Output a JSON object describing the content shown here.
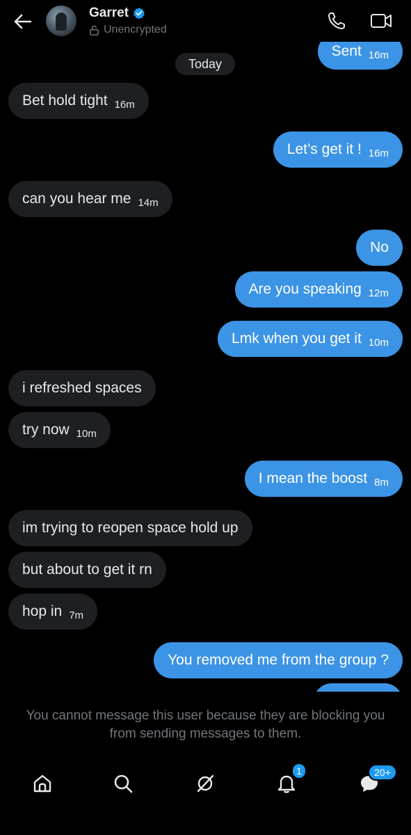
{
  "header": {
    "name": "Garret",
    "encryption_status": "Unencrypted"
  },
  "date_divider": "Today",
  "messages": [
    {
      "dir": "out",
      "text": "Sent",
      "time": "16m"
    },
    {
      "dir": "in",
      "text": "Bet hold tight",
      "time": "16m"
    },
    {
      "dir": "out",
      "text": "Let’s get it !",
      "time": "16m"
    },
    {
      "dir": "in",
      "text": "can you hear me",
      "time": "14m"
    },
    {
      "dir": "out",
      "text": "No",
      "time": ""
    },
    {
      "dir": "out",
      "text": "Are you speaking",
      "time": "12m"
    },
    {
      "dir": "out",
      "text": "Lmk when you get it",
      "time": "10m"
    },
    {
      "dir": "in",
      "text": "i refreshed spaces",
      "time": ""
    },
    {
      "dir": "in",
      "text": "try now",
      "time": "10m"
    },
    {
      "dir": "out",
      "text": "I mean the boost",
      "time": "8m"
    },
    {
      "dir": "in",
      "text": "im trying to reopen space hold up",
      "time": ""
    },
    {
      "dir": "in",
      "text": "but about to get it rn",
      "time": ""
    },
    {
      "dir": "in",
      "text": "hop in",
      "time": "7m"
    },
    {
      "dir": "out",
      "text": "You removed me from the group ?",
      "time": ""
    }
  ],
  "blocked_notice": "You cannot message this user because they are blocking you from sending messages to them.",
  "nav": {
    "notifications_badge": "1",
    "messages_badge": "20+"
  },
  "colors": {
    "accent": "#1d9bf0",
    "outgoing_bubble": "#3b94e5",
    "incoming_bubble": "#1d1f22",
    "muted_text": "#71767b",
    "background": "#000000"
  }
}
